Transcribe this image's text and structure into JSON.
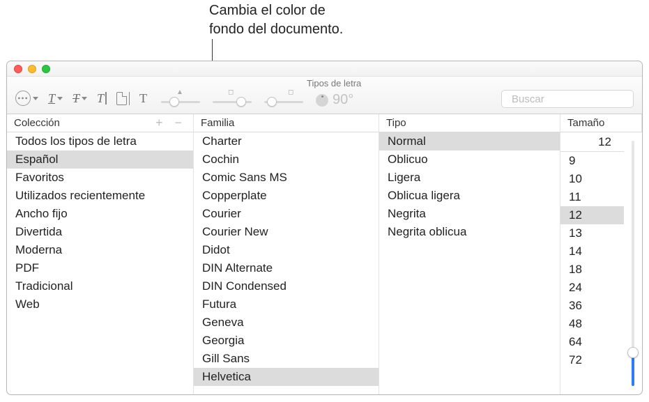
{
  "callout": {
    "line1": "Cambia el color de",
    "line2": "fondo del documento."
  },
  "toolbar": {
    "section_label": "Tipos de letra",
    "rotation": "90°"
  },
  "search": {
    "placeholder": "Buscar"
  },
  "headers": {
    "collection": "Colección",
    "family": "Familia",
    "type": "Tipo",
    "size": "Tamaño"
  },
  "collections": {
    "selected_index": 1,
    "items": [
      "Todos los tipos de letra",
      "Español",
      "Favoritos",
      "Utilizados recientemente",
      "Ancho fijo",
      "Divertida",
      "Moderna",
      "PDF",
      "Tradicional",
      "Web"
    ]
  },
  "families": {
    "selected_index": 13,
    "items": [
      "Charter",
      "Cochin",
      "Comic Sans MS",
      "Copperplate",
      "Courier",
      "Courier New",
      "Didot",
      "DIN Alternate",
      "DIN Condensed",
      "Futura",
      "Geneva",
      "Georgia",
      "Gill Sans",
      "Helvetica"
    ]
  },
  "types": {
    "selected_index": 0,
    "items": [
      "Normal",
      "Oblicuo",
      "Ligera",
      "Oblicua ligera",
      "Negrita",
      "Negrita oblicua"
    ]
  },
  "size": {
    "current": "12",
    "selected_index": 3,
    "items": [
      "9",
      "10",
      "11",
      "12",
      "13",
      "14",
      "18",
      "24",
      "36",
      "48",
      "64",
      "72"
    ]
  }
}
